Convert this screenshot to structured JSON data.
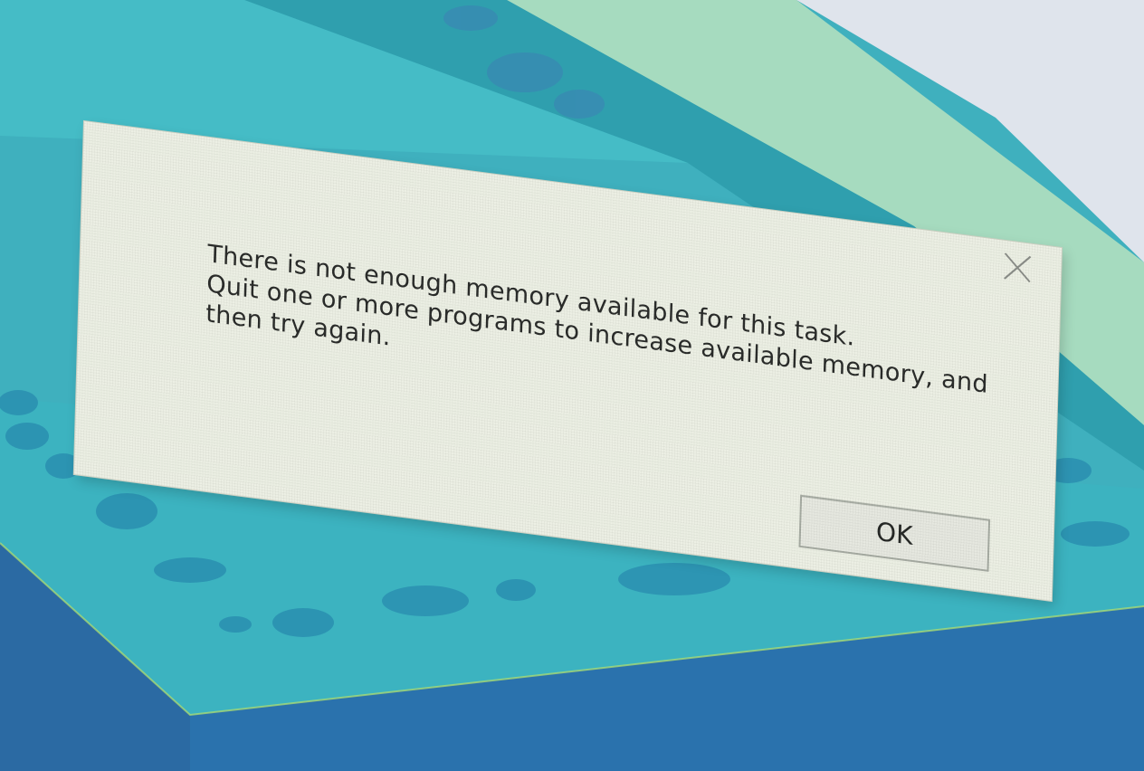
{
  "dialog": {
    "message_lines": [
      "There is not enough memory available for this task.",
      "Quit one or more programs to increase available memory, and",
      "then try again."
    ],
    "ok_label": "OK",
    "close_icon": "close-icon"
  },
  "colors": {
    "dialog_background": "#ecefe4",
    "desktop_teal": "#46b7c2",
    "desktop_blue": "#2f6fa6",
    "desktop_mint": "#9fd6b8"
  }
}
